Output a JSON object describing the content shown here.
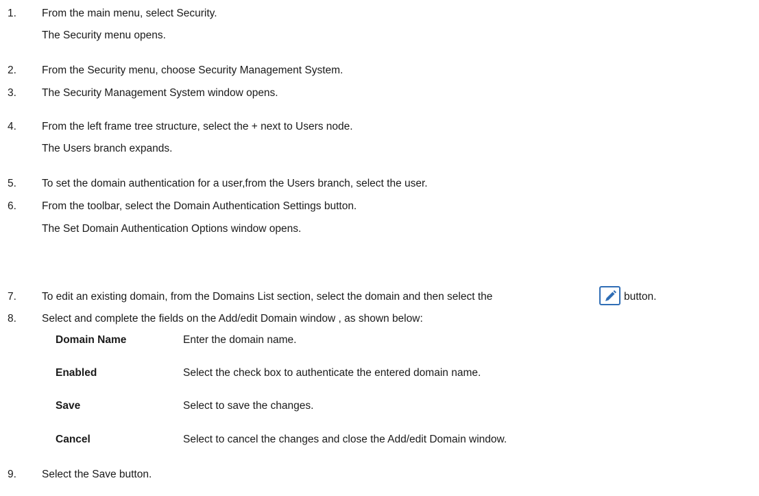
{
  "steps": [
    {
      "number": "1.",
      "text": "From the main menu, select Security.",
      "result": "The Security menu opens."
    },
    {
      "number": "2.",
      "text": "From the Security menu, choose Security Management System."
    },
    {
      "number": "3.",
      "text": "The Security Management System window opens."
    },
    {
      "number": "4.",
      "text": "From the left frame tree structure, select the + next to Users node.",
      "result": "The Users branch expands."
    },
    {
      "number": "5.",
      "text": "To set the domain authentication for a user,from the Users branch, select the user."
    },
    {
      "number": "6.",
      "text": "From the toolbar, select the Domain Authentication Settings button.",
      "result": "The Set Domain Authentication Options window opens."
    },
    {
      "number": "7.",
      "text": "To edit an existing  domain, from the Domains List section, select the domain and then select the",
      "text_after": "button.",
      "icon": "edit-pencil-icon"
    },
    {
      "number": "8.",
      "text": "Select and complete the fields on the  Add/edit Domain window  , as shown below:"
    },
    {
      "number": "9.",
      "text": "Select the Save button."
    }
  ],
  "fields": [
    {
      "term": "Domain Name",
      "definition": "Enter the domain name."
    },
    {
      "term": "Enabled",
      "definition": "Select the check box to authenticate the entered domain name."
    },
    {
      "term": "Save",
      "definition": "Select to save the changes."
    },
    {
      "term": "Cancel",
      "definition": "Select to cancel the changes and close the Add/edit Domain window."
    }
  ],
  "colors": {
    "text": "#1a1a1a",
    "icon_border": "#2f6db5",
    "icon_pencil": "#2f6db5"
  }
}
